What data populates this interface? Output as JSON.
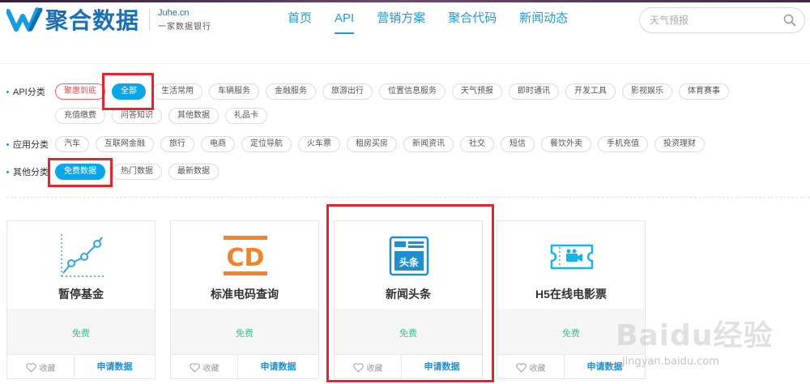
{
  "header": {
    "logo_text": "聚合数据",
    "logo_domain": "Juhe.cn",
    "logo_tagline": "一家数据银行",
    "nav": [
      {
        "label": "首页",
        "active": false
      },
      {
        "label": "API",
        "active": true
      },
      {
        "label": "营销方案",
        "active": false
      },
      {
        "label": "聚合代码",
        "active": false
      },
      {
        "label": "新闻动态",
        "active": false
      }
    ],
    "search_placeholder": "天气预报"
  },
  "filters": {
    "api": {
      "label": "API分类",
      "tags": [
        "聚惠到底",
        "全部",
        "生活常用",
        "车辆服务",
        "金融服务",
        "旅游出行",
        "位置信息服务",
        "天气预报",
        "即时通讯",
        "开发工具",
        "影视娱乐",
        "体育赛事",
        "充值缴费",
        "问答知识",
        "其他数据",
        "礼品卡"
      ]
    },
    "app": {
      "label": "应用分类",
      "tags": [
        "汽车",
        "互联网金融",
        "旅行",
        "电商",
        "定位导航",
        "火车票",
        "租房买房",
        "新闻资讯",
        "社交",
        "短信",
        "餐饮外卖",
        "手机充值",
        "投资理财"
      ]
    },
    "other": {
      "label": "其他分类",
      "tags": [
        "免费数据",
        "热门数据",
        "最新数据"
      ]
    }
  },
  "cards": [
    {
      "name": "暂停基金",
      "price": "免费",
      "fav": "收藏",
      "apply": "申请数据",
      "icon": "line-chart-icon"
    },
    {
      "name": "标准电码查询",
      "price": "免费",
      "fav": "收藏",
      "apply": "申请数据",
      "icon": "cd-code-icon"
    },
    {
      "name": "新闻头条",
      "price": "免费",
      "fav": "收藏",
      "apply": "申请数据",
      "icon": "news-headline-icon"
    },
    {
      "name": "H5在线电影票",
      "price": "免费",
      "fav": "收藏",
      "apply": "申请数据",
      "icon": "movie-ticket-icon"
    }
  ],
  "watermark": {
    "brand": "Baidu经验",
    "url": "jingyan.baidu.com"
  },
  "colors": {
    "accent": "#1f9bd7",
    "active_tag": "#0aa6e8",
    "highlight": "#e8232b",
    "free": "#3cc48a"
  }
}
